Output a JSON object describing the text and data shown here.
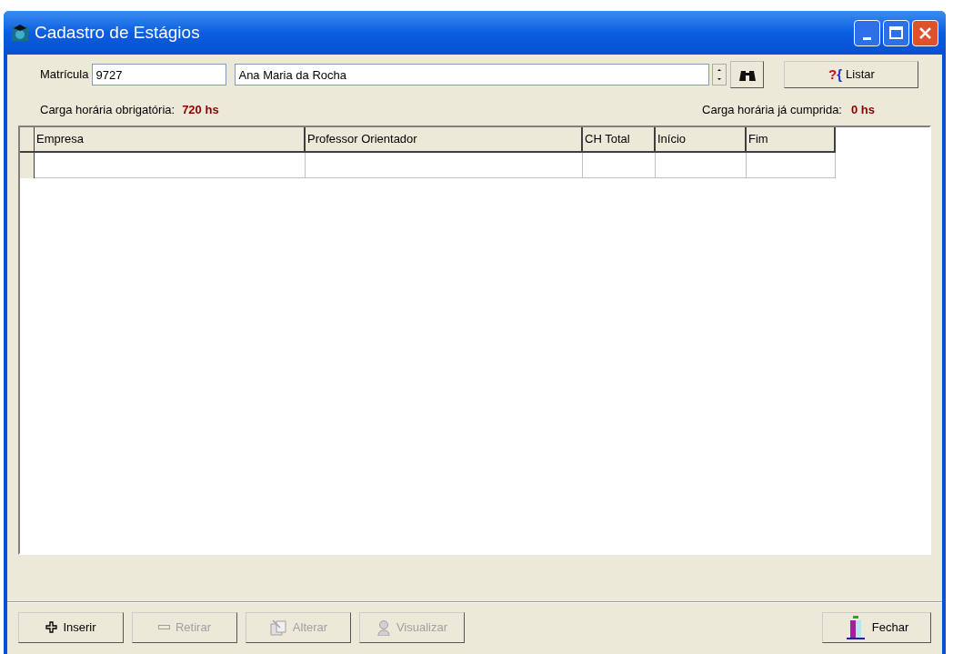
{
  "window": {
    "title": "Cadastro de Estágios"
  },
  "form": {
    "matricula_label": "Matrícula",
    "matricula_value": "9727",
    "name_value": "Ana Maria da Rocha",
    "list_button": {
      "icon_text": "?{",
      "label": "Listar"
    }
  },
  "summary": {
    "required_label": "Carga horária obrigatória:",
    "required_value": "720 hs",
    "done_label": "Carga horária já cumprida:",
    "done_value": "0 hs"
  },
  "table": {
    "columns": [
      "Empresa",
      "Professor Orientador",
      "CH Total",
      "Início",
      "Fim"
    ]
  },
  "buttons": [
    {
      "label": "Inserir",
      "kind": "plus",
      "disabled": false
    },
    {
      "label": "Retirar",
      "kind": "minus",
      "disabled": true
    },
    {
      "label": "Alterar",
      "kind": "edit",
      "disabled": true
    },
    {
      "label": "Visualizar",
      "kind": "view",
      "disabled": true
    }
  ],
  "close_button": {
    "label": "Fechar"
  }
}
